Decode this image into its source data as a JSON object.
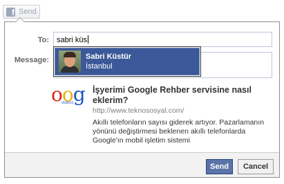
{
  "top_button": {
    "label": "Send",
    "icon": "facebook-f-icon"
  },
  "form": {
    "to_label": "To:",
    "to_value": "sabri küs",
    "message_label": "Message:",
    "message_value": ""
  },
  "suggestion": {
    "name": "Sabri Küstür",
    "city": "İstanbul"
  },
  "preview": {
    "thumb_letters": [
      "o",
      "o",
      "g"
    ],
    "thumb_caption": "videos",
    "title": "İşyerimi Google Rehber servisine nasıl eklerim?",
    "url": "http://www.teknososyal.com/",
    "description": "Akıllı telefonların sayısı giderek artıyor. Pazarlamanın yönünü değiştirmesi beklenen akıllı telefonlarda Google'ın mobil işletim sistemi"
  },
  "buttons": {
    "send": "Send",
    "cancel": "Cancel"
  },
  "colors": {
    "accent": "#3b5998",
    "send_button": "#5b74a8"
  }
}
